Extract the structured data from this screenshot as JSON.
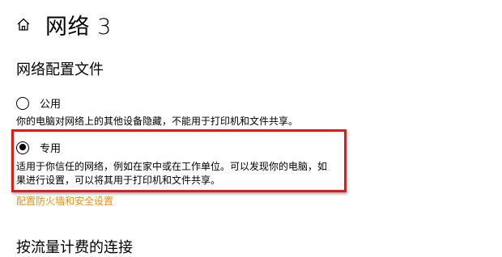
{
  "header": {
    "title": "网络 3",
    "home_icon": "home-icon"
  },
  "profile": {
    "section_title": "网络配置文件",
    "public": {
      "label": "公用",
      "selected": false,
      "description": "你的电脑对网络上的其他设备隐藏，不能用于打印机和文件共享。"
    },
    "private": {
      "label": "专用",
      "selected": true,
      "description_line1": "适用于你信任的网络，例如在家中或在工作单位。可以发现你的电脑，如",
      "description_line2": "果进行设置，可以将其用于打印机和文件共享。"
    },
    "firewall_link": "配置防火墙和安全设置"
  },
  "metered": {
    "section_title": "按流量计费的连接"
  },
  "colors": {
    "highlight_border": "#e01b1b",
    "link": "#e8920c"
  }
}
